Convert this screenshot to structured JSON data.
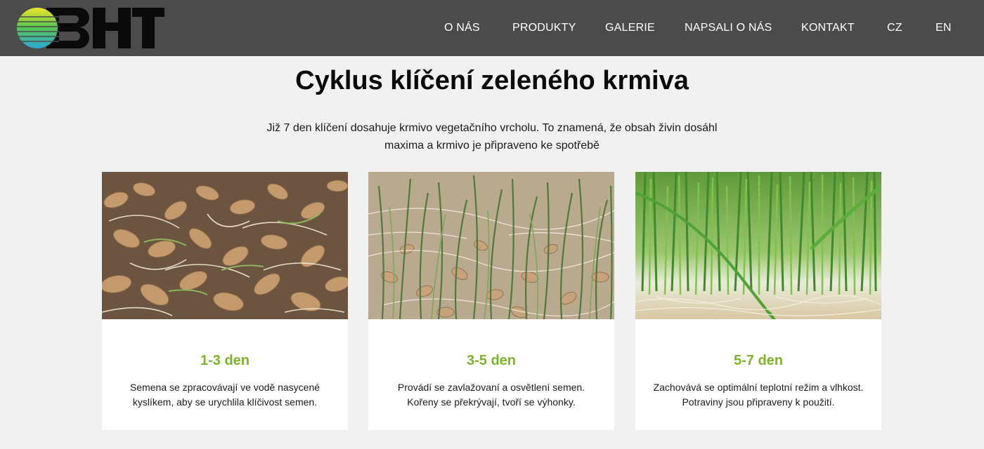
{
  "header": {
    "logo_text": "BHT",
    "nav": [
      {
        "label": "O NÁS"
      },
      {
        "label": "PRODUKTY"
      },
      {
        "label": "GALERIE"
      },
      {
        "label": "NAPSALI O NÁS"
      },
      {
        "label": "KONTAKT"
      },
      {
        "label": "CZ"
      },
      {
        "label": "EN"
      }
    ]
  },
  "main": {
    "title": "Cyklus klíčení zeleného krmiva",
    "intro_line1": "Již 7 den klíčení dosahuje krmivo vegetačního vrcholu. To znamená, že obsah živin dosáhl",
    "intro_line2": "maxima a krmivo je připraveno ke spotřebě",
    "cards": [
      {
        "title": "1-3 den",
        "text_line1": "Semena se zpracovávají ve vodě nasycené",
        "text_line2": "kyslíkem, aby se urychlila klíčivost semen.",
        "image": "sprouting-grain-photo"
      },
      {
        "title": "3-5 den",
        "text_line1": "Provádí se zavlažovaní a osvětlení semen.",
        "text_line2": "Kořeny se překrývají, tvoří se výhonky.",
        "image": "young-shoots-photo"
      },
      {
        "title": "5-7 den",
        "text_line1": "Zachovává se optimální teplotní režim a vlhkost.",
        "text_line2": "Potraviny jsou připraveny k použití.",
        "image": "green-grass-photo"
      }
    ]
  },
  "colors": {
    "header_bg": "#4b4b4b",
    "page_bg": "#f1f1f1",
    "accent_green": "#7db52a"
  }
}
